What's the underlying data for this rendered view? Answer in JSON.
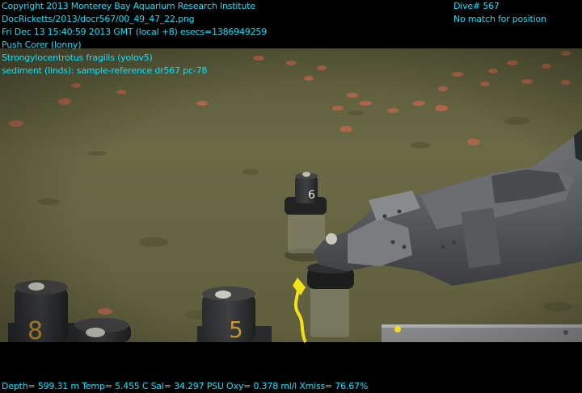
{
  "overlay": {
    "left_lines": [
      "Copyright 2013 Monterey Bay Aquarium Research Institute",
      "DocRicketts/2013/docr567/00_49_47_22.png",
      "Fri Dec 13 15:40:59 2013 GMT (local +8)  esecs=1386949259",
      "Push Corer (lonny)",
      "Strongylocentrotus fragilis (yolov5)",
      "sediment (linds): sample-reference dr567 pc-78"
    ],
    "right_lines": [
      "Dive# 567",
      "No match for position"
    ],
    "bottom_line": "Depth= 599.31 m  Temp= 5.455 C  Sal= 34.297 PSU  Oxy= 0.378 ml/l  Xmiss= 76.67%"
  },
  "scene": {
    "core_tube_labels": [
      "6",
      "8",
      "5"
    ],
    "colors": {
      "seafloor": "#6b6a45",
      "seafloor_dark": "#4c4b30",
      "urchin": "#b8664a",
      "overlay_text": "#00e5ff",
      "arm": "#5a5b5e",
      "sample_tag": "#f2e21a"
    }
  }
}
